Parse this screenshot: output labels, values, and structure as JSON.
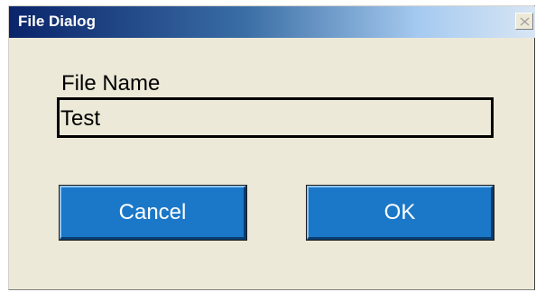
{
  "window": {
    "title": "File Dialog",
    "close_icon": "close-icon"
  },
  "form": {
    "file_name_label": "File Name",
    "file_name_value": "Test"
  },
  "buttons": {
    "cancel_label": "Cancel",
    "ok_label": "OK"
  },
  "colors": {
    "titlebar_start": "#0a246a",
    "titlebar_end": "#d8e6f4",
    "dialog_bg": "#ece9d8",
    "button_bg": "#1b78c8",
    "button_text": "#ffffff"
  }
}
